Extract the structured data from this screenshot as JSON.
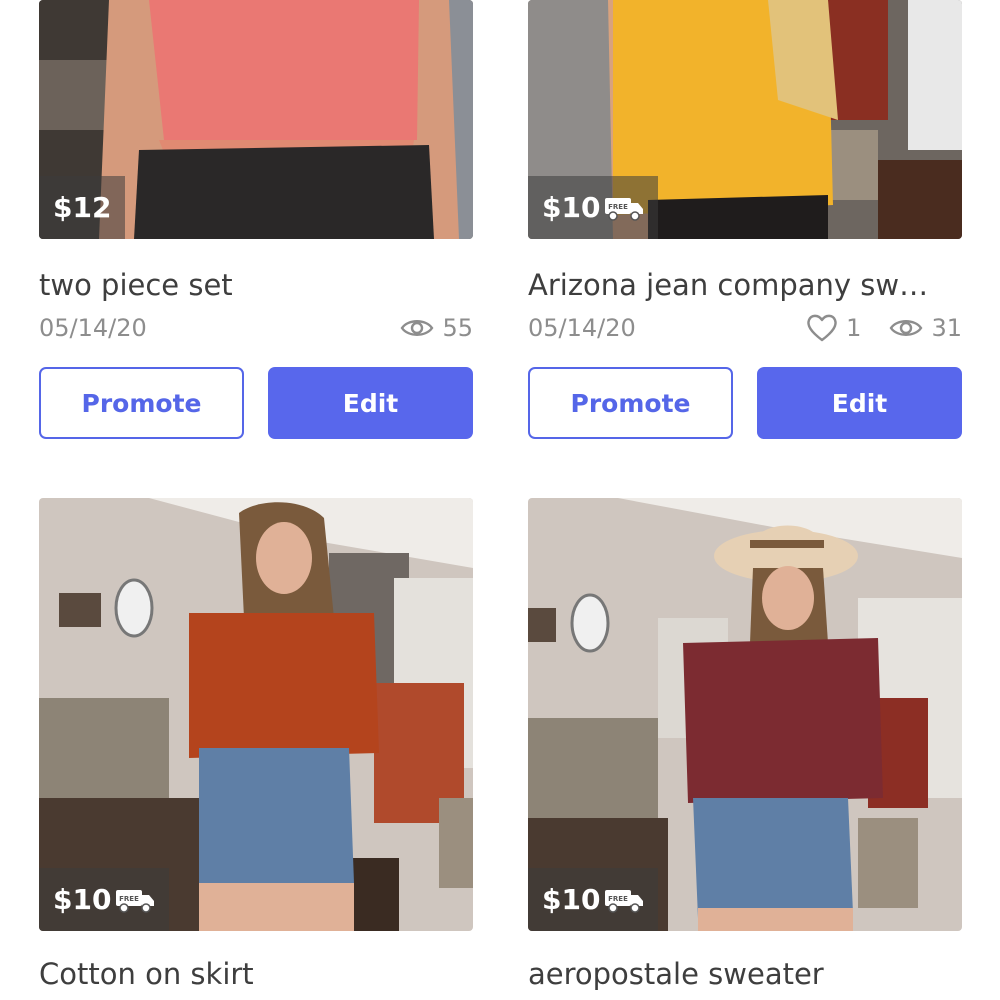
{
  "colors": {
    "accent": "#5867ec",
    "text": "#3e3e3e",
    "muted": "#8d8d8d"
  },
  "listings": [
    {
      "price": "$12",
      "free_shipping": false,
      "title": "two piece set",
      "date": "05/14/20",
      "likes": "",
      "views": "55",
      "promote_label": "Promote",
      "edit_label": "Edit"
    },
    {
      "price": "$10",
      "free_shipping": true,
      "free_label": "FREE",
      "title": "Arizona jean company sw…",
      "date": "05/14/20",
      "likes": "1",
      "views": "31",
      "promote_label": "Promote",
      "edit_label": "Edit"
    },
    {
      "price": "$10",
      "free_shipping": true,
      "free_label": "FREE",
      "title": "Cotton on skirt"
    },
    {
      "price": "$10",
      "free_shipping": true,
      "free_label": "FREE",
      "title": "aeropostale sweater"
    }
  ]
}
